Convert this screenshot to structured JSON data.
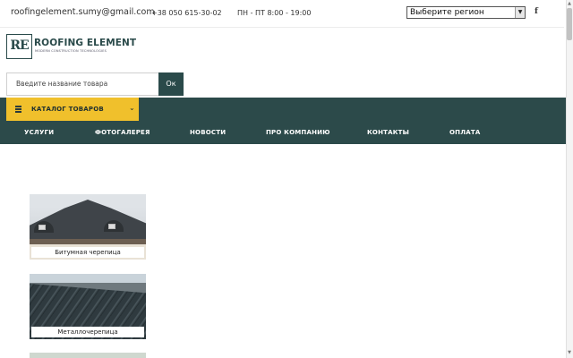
{
  "topbar": {
    "email": "roofingelement.sumy@gmail.com",
    "phone": "+38 050 615-30-02",
    "hours": "ПН - ПТ 8:00 - 19:00",
    "region_select": {
      "selected": "Выберите регион"
    },
    "social": {
      "facebook_glyph": "f"
    }
  },
  "logo": {
    "mark": "RE",
    "name": "ROOFING ELEMENT",
    "tagline": "MODERN CONSTRUCTION TECHNOLOGIES"
  },
  "search": {
    "placeholder": "Введите название товара",
    "button": "Ок"
  },
  "catalog": {
    "label": "КАТАЛОГ ТОВАРОВ"
  },
  "menu": {
    "items": [
      {
        "label": "УСЛУГИ"
      },
      {
        "label": "ФОТОГАЛЕРЕЯ"
      },
      {
        "label": "НОВОСТИ"
      },
      {
        "label": "ПРО КОМПАНИЮ"
      },
      {
        "label": "КОНТАКТЫ"
      },
      {
        "label": "ОПЛАТА"
      }
    ]
  },
  "categories": [
    {
      "label": "Битумная черепица"
    },
    {
      "label": "Металлочерепица"
    }
  ],
  "colors": {
    "brand_dark": "#2c4a4a",
    "accent_yellow": "#f0c02c"
  },
  "icons": {
    "menu": "hamburger-icon",
    "catalog_toggle": "chevron-down-icon",
    "select_arrow": "dropdown-arrow-icon",
    "social": "facebook-icon"
  }
}
